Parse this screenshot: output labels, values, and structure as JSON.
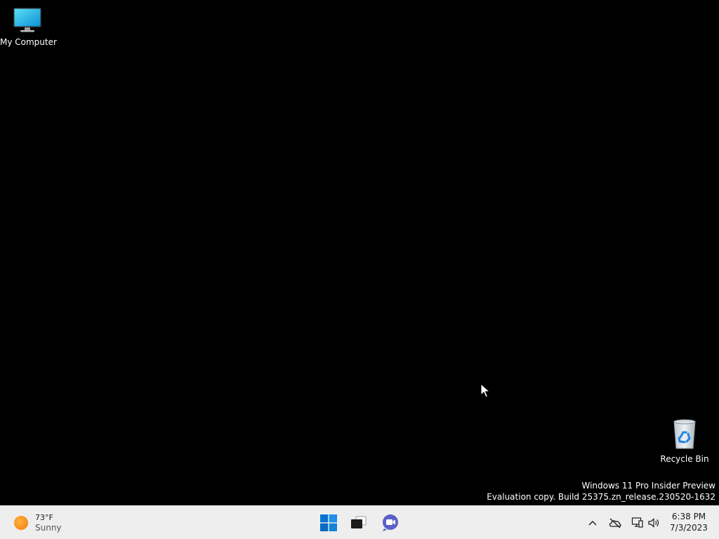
{
  "desktop": {
    "icons": [
      {
        "label": "My Computer",
        "icon": "monitor-icon"
      },
      {
        "label": "Recycle Bin",
        "icon": "recycle-bin-icon"
      }
    ],
    "watermark": {
      "line1": "Windows 11 Pro Insider Preview",
      "line2": "Evaluation copy. Build 25375.zn_release.230520-1632"
    }
  },
  "taskbar": {
    "weather": {
      "temperature": "73°F",
      "condition": "Sunny",
      "icon": "sun-icon"
    },
    "pinned": [
      {
        "name": "Start",
        "icon": "windows-logo-icon"
      },
      {
        "name": "Task View",
        "icon": "task-view-icon"
      },
      {
        "name": "Meet Now",
        "icon": "video-call-icon"
      }
    ],
    "tray": {
      "icons": [
        "chevron-up-icon",
        "onedrive-offline-icon",
        "network-icon",
        "volume-icon"
      ]
    },
    "clock": {
      "time": "6:38 PM",
      "date": "7/3/2023"
    }
  },
  "colors": {
    "desktop_background": "#000000",
    "taskbar_background": "#eeeeee",
    "windows_blue": "#0078d4",
    "meet_purple": "#5b5fc7"
  }
}
